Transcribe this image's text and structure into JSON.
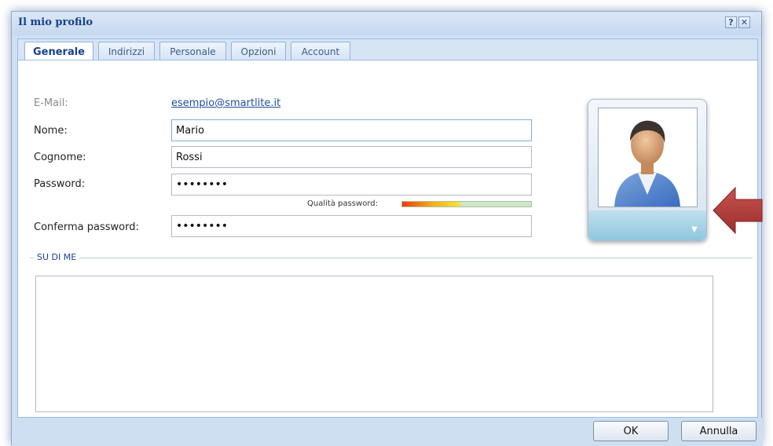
{
  "window": {
    "title": "Il mio profilo"
  },
  "tools": {
    "help": "?",
    "close": "✕"
  },
  "tabs": [
    {
      "label": "Generale",
      "active": true
    },
    {
      "label": "Indirizzi",
      "active": false
    },
    {
      "label": "Personale",
      "active": false
    },
    {
      "label": "Opzioni",
      "active": false
    },
    {
      "label": "Account",
      "active": false
    }
  ],
  "form": {
    "email_label": "E-Mail:",
    "email_value": "esempio@smartlite.it",
    "nome_label": "Nome:",
    "nome_value": "Mario",
    "cognome_label": "Cognome:",
    "cognome_value": "Rossi",
    "password_label": "Password:",
    "password_value": "••••••••",
    "quality_label": "Qualità password:",
    "quality_level": 0.45,
    "confirm_label": "Conferma password:",
    "confirm_value": "••••••••",
    "about_legend": "SU DI ME",
    "about_value": ""
  },
  "buttons": {
    "ok": "OK",
    "cancel": "Annulla"
  },
  "colors": {
    "accent": "#15428b",
    "callout": "#b53a38"
  },
  "icons": {
    "avatar": "user-avatar-icon",
    "avatar_menu": "chevron-down-icon",
    "callout": "left-arrow-icon"
  }
}
